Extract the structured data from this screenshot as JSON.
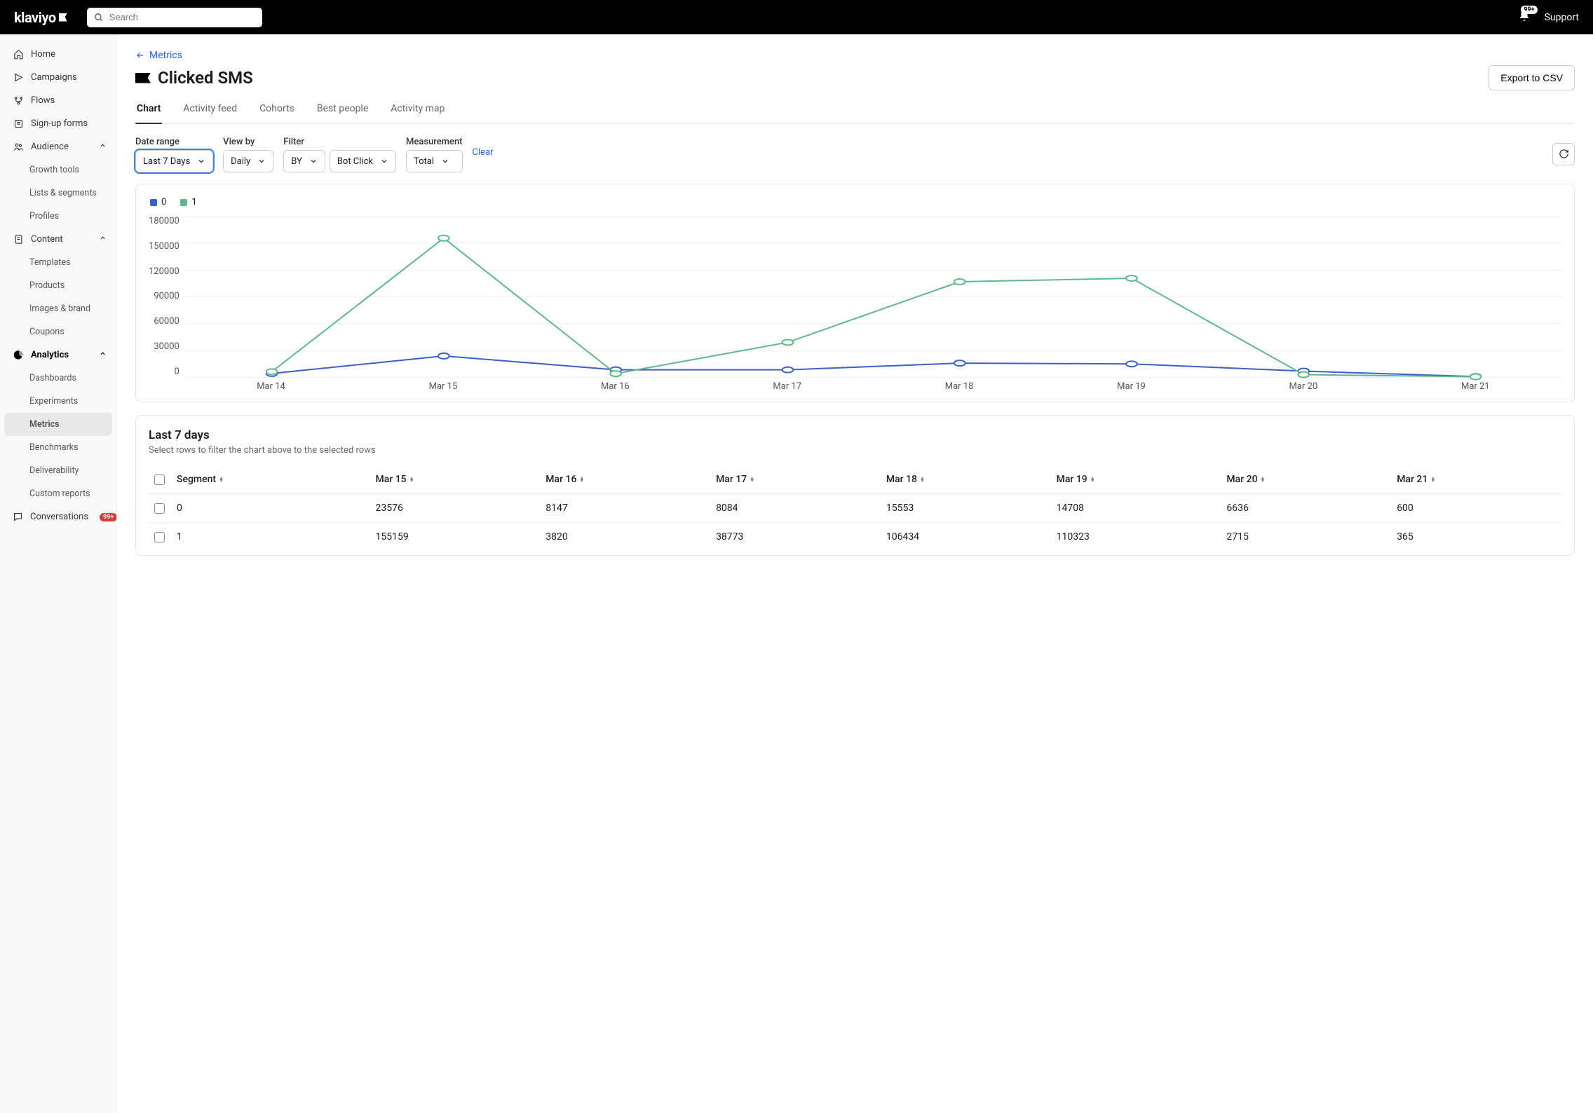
{
  "header": {
    "logo": "klaviyo",
    "search_placeholder": "Search",
    "notif_badge": "99+",
    "support": "Support"
  },
  "sidebar": {
    "items": [
      {
        "label": "Home",
        "type": "top",
        "icon": "home"
      },
      {
        "label": "Campaigns",
        "type": "top",
        "icon": "send"
      },
      {
        "label": "Flows",
        "type": "top",
        "icon": "flow"
      },
      {
        "label": "Sign-up forms",
        "type": "top",
        "icon": "form"
      },
      {
        "label": "Audience",
        "type": "top",
        "icon": "people",
        "expandable": true
      },
      {
        "label": "Growth tools",
        "type": "sub"
      },
      {
        "label": "Lists & segments",
        "type": "sub"
      },
      {
        "label": "Profiles",
        "type": "sub"
      },
      {
        "label": "Content",
        "type": "top",
        "icon": "doc",
        "expandable": true
      },
      {
        "label": "Templates",
        "type": "sub"
      },
      {
        "label": "Products",
        "type": "sub"
      },
      {
        "label": "Images & brand",
        "type": "sub"
      },
      {
        "label": "Coupons",
        "type": "sub"
      },
      {
        "label": "Analytics",
        "type": "top",
        "icon": "pie",
        "expandable": true,
        "active": true
      },
      {
        "label": "Dashboards",
        "type": "sub"
      },
      {
        "label": "Experiments",
        "type": "sub"
      },
      {
        "label": "Metrics",
        "type": "sub",
        "selected": true
      },
      {
        "label": "Benchmarks",
        "type": "sub"
      },
      {
        "label": "Deliverability",
        "type": "sub"
      },
      {
        "label": "Custom reports",
        "type": "sub"
      },
      {
        "label": "Conversations",
        "type": "top",
        "icon": "chat",
        "badge": "99+"
      }
    ]
  },
  "page": {
    "breadcrumb": "Metrics",
    "title": "Clicked SMS",
    "export": "Export to CSV"
  },
  "tabs": [
    "Chart",
    "Activity feed",
    "Cohorts",
    "Best people",
    "Activity map"
  ],
  "controls": {
    "date_range_label": "Date range",
    "date_range_value": "Last 7 Days",
    "view_by_label": "View by",
    "view_by_value": "Daily",
    "filter_label": "Filter",
    "filter_by_value": "BY",
    "filter_prop_value": "Bot Click",
    "measurement_label": "Measurement",
    "measurement_value": "Total",
    "clear": "Clear"
  },
  "chart_data": {
    "type": "line",
    "categories": [
      "Mar 14",
      "Mar 15",
      "Mar 16",
      "Mar 17",
      "Mar 18",
      "Mar 19",
      "Mar 20",
      "Mar 21"
    ],
    "series": [
      {
        "name": "0",
        "color": "#3a5fc8",
        "values": [
          4000,
          23576,
          8147,
          8084,
          15553,
          14708,
          6636,
          600
        ]
      },
      {
        "name": "1",
        "color": "#5fb88a",
        "values": [
          6000,
          155159,
          3820,
          38773,
          106434,
          110323,
          2715,
          365
        ]
      }
    ],
    "ylim": [
      0,
      180000
    ],
    "y_ticks": [
      180000,
      150000,
      120000,
      90000,
      60000,
      30000,
      0
    ]
  },
  "table": {
    "title": "Last 7 days",
    "subtitle": "Select rows to filter the chart above to the selected rows",
    "columns": [
      "Segment",
      "Mar 15",
      "Mar 16",
      "Mar 17",
      "Mar 18",
      "Mar 19",
      "Mar 20",
      "Mar 21"
    ],
    "rows": [
      {
        "segment": "0",
        "cells": [
          "23576",
          "8147",
          "8084",
          "15553",
          "14708",
          "6636",
          "600"
        ]
      },
      {
        "segment": "1",
        "cells": [
          "155159",
          "3820",
          "38773",
          "106434",
          "110323",
          "2715",
          "365"
        ]
      }
    ]
  }
}
